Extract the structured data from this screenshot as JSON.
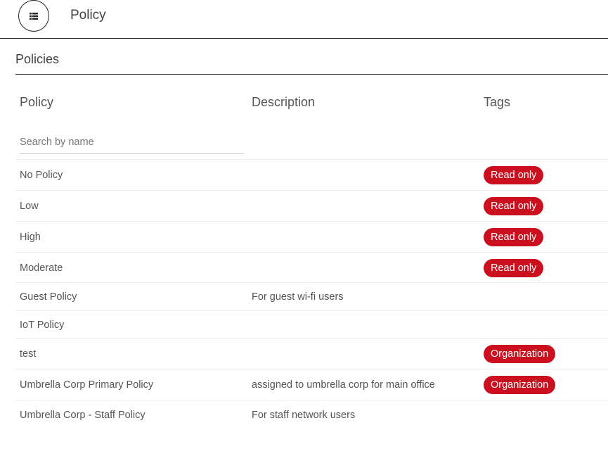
{
  "header": {
    "title": "Policy",
    "menu_icon": "list-icon"
  },
  "section": {
    "title": "Policies"
  },
  "table": {
    "columns": [
      "Policy",
      "Description",
      "Tags"
    ],
    "search_placeholder": "Search by name",
    "tag_color": "#cc0f1e",
    "rows": [
      {
        "name": "No Policy",
        "description": "",
        "tag": "Read only"
      },
      {
        "name": "Low",
        "description": "",
        "tag": "Read only"
      },
      {
        "name": "High",
        "description": "",
        "tag": "Read only"
      },
      {
        "name": "Moderate",
        "description": "",
        "tag": "Read only"
      },
      {
        "name": "Guest Policy",
        "description": "For guest wi-fi users",
        "tag": ""
      },
      {
        "name": "IoT Policy",
        "description": "",
        "tag": ""
      },
      {
        "name": "test",
        "description": "",
        "tag": "Organization"
      },
      {
        "name": "Umbrella Corp Primary Policy",
        "description": "assigned to umbrella corp for main office",
        "tag": "Organization"
      },
      {
        "name": "Umbrella Corp - Staff Policy",
        "description": "For staff network users",
        "tag": ""
      }
    ]
  }
}
